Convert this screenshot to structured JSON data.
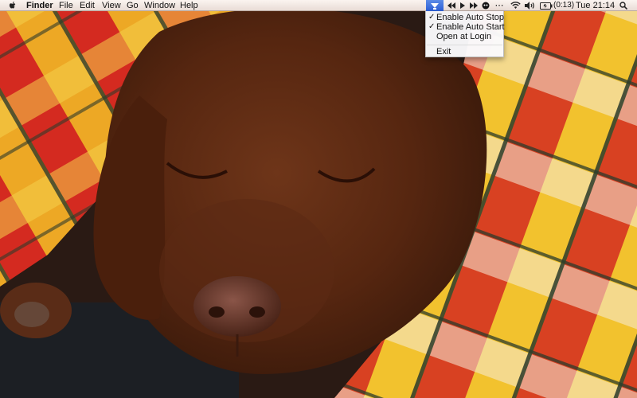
{
  "menubar": {
    "app_name": "Finder",
    "menus": [
      "File",
      "Edit",
      "View",
      "Go",
      "Window",
      "Help"
    ],
    "status_icons": [
      "status-app-icon",
      "previous-track-icon",
      "play-icon",
      "next-track-icon",
      "circle-status-icon",
      "more-icon",
      "wifi-icon",
      "volume-icon",
      "battery-icon"
    ],
    "battery_time": "(0:13)",
    "clock": "Tue 21:14"
  },
  "dropdown": {
    "items": [
      {
        "label": "Enable Auto Stop",
        "checked": true,
        "check": "✓"
      },
      {
        "label": "Enable Auto Start",
        "checked": true,
        "check": "✓"
      },
      {
        "label": "Open at Login",
        "checked": false,
        "check": ""
      },
      {
        "label": "Exit",
        "checked": false,
        "check": ""
      }
    ]
  },
  "colors": {
    "accent": "#2d5fd6",
    "blanket_red": "#d42a20",
    "blanket_yellow": "#f2c22e",
    "dog_brown": "#5a2a15"
  },
  "more_glyph": "⋯"
}
